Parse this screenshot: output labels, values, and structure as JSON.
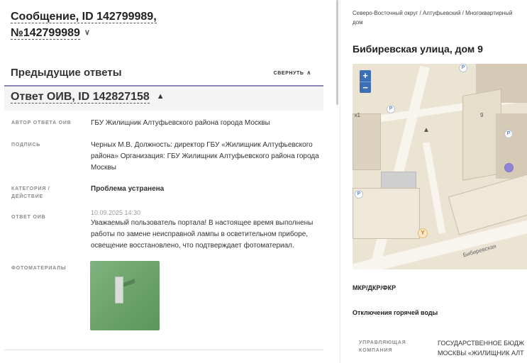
{
  "message": {
    "title_line1": "Сообщение, ID 142799989,",
    "title_line2": "№142799989",
    "chevron": "chevron-down-icon"
  },
  "previous_answers": {
    "title": "Предыдущие ответы",
    "collapse_label": "СВЕРНУТЬ"
  },
  "answer": {
    "title": "Ответ ОИВ, ID 142827158",
    "fields": {
      "author_label": "АВТОР ОТВЕТА ОИВ",
      "author_value": "ГБУ Жилищник Алтуфьевского района города Москвы",
      "signature_label": "ПОДПИСЬ",
      "signature_value": "Черных М.В. Должность: директор ГБУ «Жилищник Алтуфьевского района» Организация: ГБУ Жилищник Алтуфьевского района города Москвы",
      "category_label": "КАТЕГОРИЯ / ДЕЙСТВИЕ",
      "category_value": "Проблема устранена",
      "response_label": "ОТВЕТ ОИВ",
      "response_date": "10.09.2025 14:30",
      "response_text": "Уважаемый пользователь портала! В настоящее время выполнены работы по замене неисправной лампы в осветительном приборе, освещение восстановлено, что подтверждает фотоматериал.",
      "photo_label": "ФОТОМАТЕРИАЛЫ"
    }
  },
  "right_panel": {
    "breadcrumb": "Северо-Восточный округ / Алтуфьевский / Многоквартирный дом",
    "address": "Бибиревская улица, дом 9",
    "map": {
      "zoom_in": "+",
      "zoom_out": "−",
      "building_number": "9",
      "building_k1": "к1",
      "street_name": "Бибиревская",
      "marker_color": "#8f85d6"
    },
    "section_mkr": "МКР/ДКР/ФКР",
    "section_hot_water": "Отключения горячей воды",
    "management_label": "УПРАВЛЯЮЩАЯ КОМПАНИЯ",
    "management_value_line1": "ГОСУДАРСТВЕННОЕ БЮДЖ",
    "management_value_line2": "МОСКВЫ «ЖИЛИЩНИК АЛТ"
  }
}
